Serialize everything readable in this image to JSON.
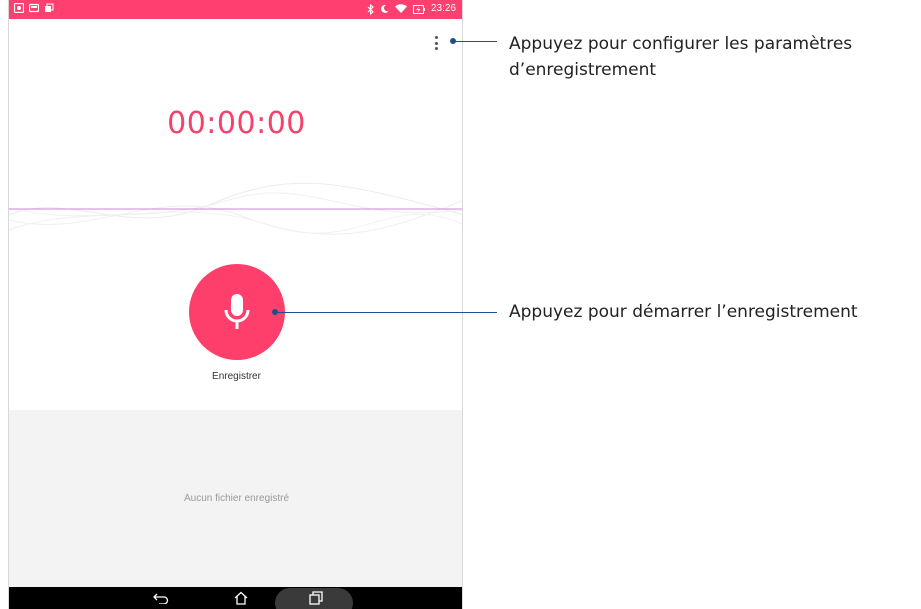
{
  "status_bar": {
    "time": "23:26",
    "accent_color": "#ff3f6f",
    "left_icons": [
      "notification-icon",
      "image-icon",
      "app-icon"
    ],
    "right_icons": [
      "bluetooth-icon",
      "moon-icon",
      "wifi-icon",
      "battery-charging-icon"
    ]
  },
  "recorder": {
    "timer": "00:00:00",
    "record_label": "Enregistrer",
    "record_color": "#ff3f6b",
    "empty_message": "Aucun fichier enregistré",
    "menu_icon": "more-vertical-icon",
    "record_icon": "microphone-icon"
  },
  "nav_bar": {
    "icons": [
      "back-icon",
      "home-icon",
      "recents-icon"
    ]
  },
  "callouts": {
    "settings_line1": "Appuyez pour configurer les paramètres",
    "settings_line2": "d’enregistrement",
    "record": "Appuyez pour démarrer l’enregistrement",
    "line_color": "#1f4e8c"
  }
}
